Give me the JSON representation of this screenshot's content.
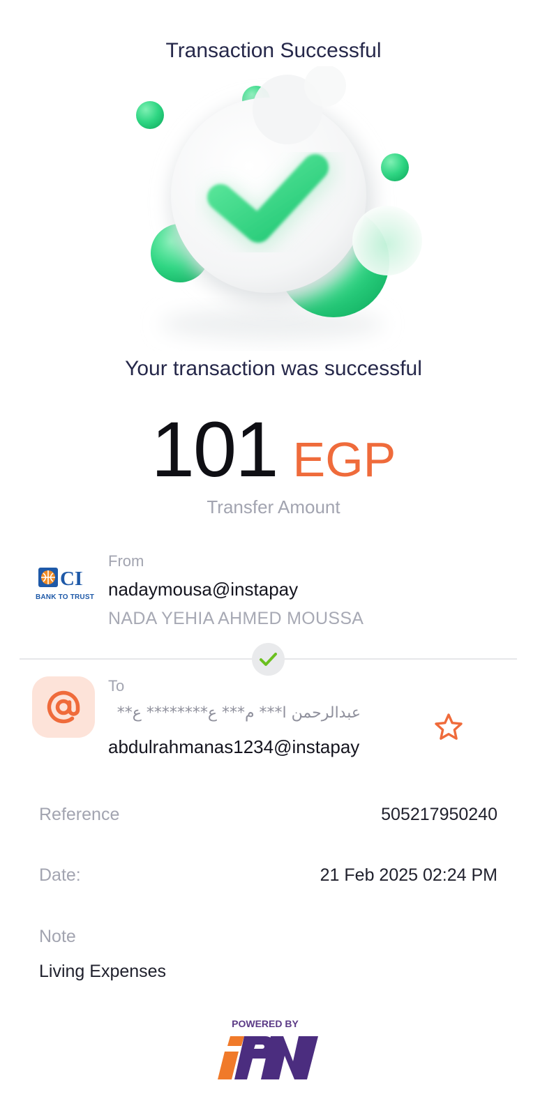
{
  "header": {
    "title": "Transaction Successful"
  },
  "status": {
    "message": "Your transaction was successful"
  },
  "amount": {
    "value": "101",
    "currency": "EGP",
    "caption": "Transfer Amount"
  },
  "from": {
    "label": "From",
    "handle": "nadaymousa@instapay",
    "account_name": "NADA YEHIA AHMED MOUSSA",
    "bank_logo_text": "CIB",
    "bank_tagline": "BANK TO TRUST"
  },
  "to": {
    "label": "To",
    "name_arabic": "عبدالرحمن ا*** م*** ع******** ع**",
    "handle": "abdulrahmanas1234@instapay",
    "badge_icon": "at-sign-icon",
    "favorite_icon": "star-outline-icon"
  },
  "details": {
    "reference_label": "Reference",
    "reference_value": "505217950240",
    "date_label": "Date:",
    "date_value": "21 Feb 2025 02:24 PM",
    "note_label": "Note",
    "note_value": "Living Expenses"
  },
  "footer": {
    "powered_by": "POWERED BY",
    "brand_logo": "IPN"
  },
  "colors": {
    "accent_orange": "#ef6b3b",
    "success_green": "#2fd683",
    "verified_green": "#6bc020",
    "purple": "#4b2d7f"
  }
}
